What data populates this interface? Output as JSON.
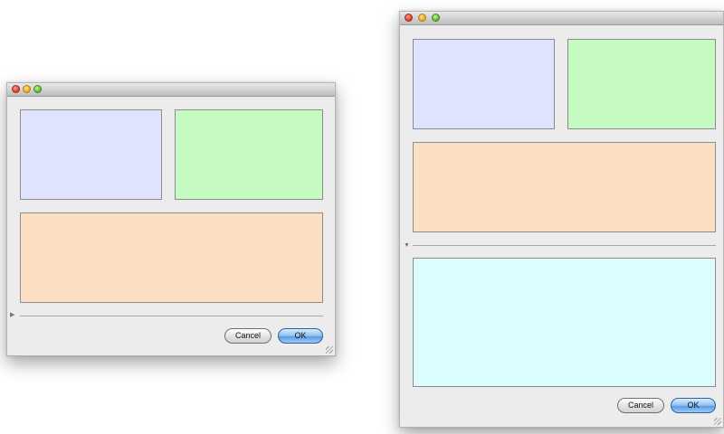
{
  "colors": {
    "panel_blue": "#dfe3fd",
    "panel_green": "#c5fbc0",
    "panel_orange": "#fcdfc3",
    "panel_cyan": "#dcfdfd",
    "window_bg": "#ececec"
  },
  "window_collapsed": {
    "disclosure_state": "collapsed",
    "buttons": {
      "cancel_label": "Cancel",
      "ok_label": "OK"
    }
  },
  "window_expanded": {
    "disclosure_state": "expanded",
    "buttons": {
      "cancel_label": "Cancel",
      "ok_label": "OK"
    }
  },
  "icons": [
    "close-icon",
    "minimize-icon",
    "zoom-icon",
    "disclosure-triangle-icon",
    "resize-grip-icon"
  ]
}
